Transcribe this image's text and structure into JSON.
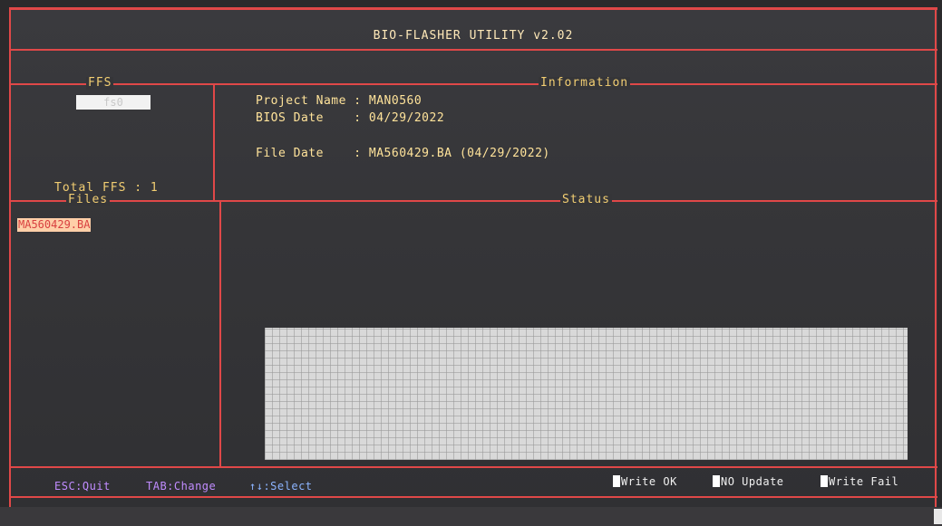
{
  "title": "BIO-FLASHER UTILITY v2.02",
  "ffs_panel": {
    "label": "FFS",
    "selected": "fs0",
    "total": "Total FFS : 1"
  },
  "info_panel": {
    "label": "Information",
    "project_name": "Project Name : MAN0560",
    "bios_date": "BIOS Date    : 04/29/2022",
    "file_date": "File Date    : MA560429.BA (04/29/2022)"
  },
  "files_panel": {
    "label": "Files",
    "items": [
      "MA560429.BA"
    ]
  },
  "status_panel": {
    "label": "Status"
  },
  "help_bar": {
    "esc": "ESC:Quit",
    "tab": "TAB:Change",
    "select": "↑↓:Select"
  },
  "legend": {
    "write_ok": "Write OK",
    "no_update": "NO Update",
    "write_fail": "Write Fail"
  },
  "colors": {
    "frame_red": "#e04848",
    "text_yellow": "#ffe39a",
    "help_purple": "#c08cff",
    "select_blue": "#8cb4ff"
  }
}
